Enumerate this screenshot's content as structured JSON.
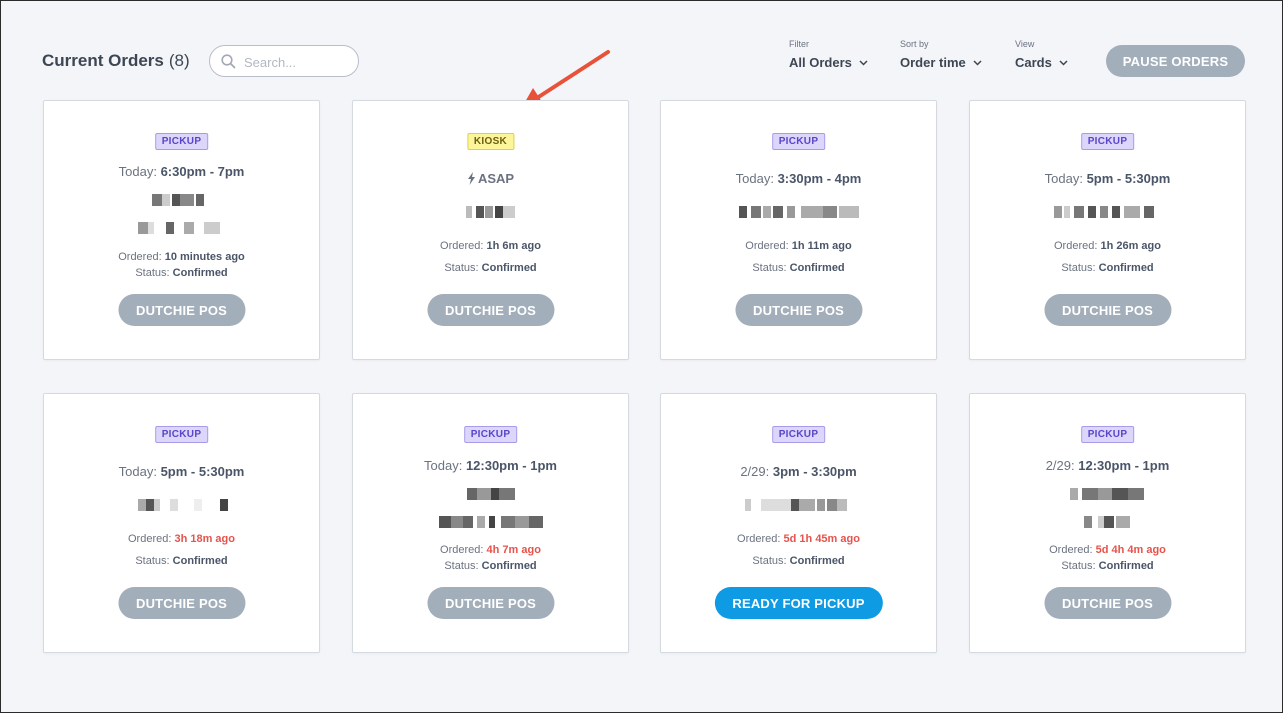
{
  "header": {
    "title": "Current Orders",
    "count": "(8)",
    "search_placeholder": "Search...",
    "filter": {
      "label": "Filter",
      "value": "All Orders"
    },
    "sort": {
      "label": "Sort by",
      "value": "Order time"
    },
    "view": {
      "label": "View",
      "value": "Cards"
    },
    "pause_label": "PAUSE ORDERS"
  },
  "labels": {
    "ordered": "Ordered:",
    "status": "Status:"
  },
  "orders": [
    {
      "type": "PICKUP",
      "time_prefix": "Today:",
      "time_range": "6:30pm - 7pm",
      "ordered_ago": "10 minutes ago",
      "status": "Confirmed",
      "action": "DUTCHIE POS"
    },
    {
      "type": "KIOSK",
      "time_prefix": "",
      "time_range": "ASAP",
      "ordered_ago": "1h 6m ago",
      "status": "Confirmed",
      "action": "DUTCHIE POS"
    },
    {
      "type": "PICKUP",
      "time_prefix": "Today:",
      "time_range": "3:30pm - 4pm",
      "ordered_ago": "1h 11m ago",
      "status": "Confirmed",
      "action": "DUTCHIE POS"
    },
    {
      "type": "PICKUP",
      "time_prefix": "Today:",
      "time_range": "5pm - 5:30pm",
      "ordered_ago": "1h 26m ago",
      "status": "Confirmed",
      "action": "DUTCHIE POS"
    },
    {
      "type": "PICKUP",
      "time_prefix": "Today:",
      "time_range": "5pm - 5:30pm",
      "ordered_ago": "3h 18m ago",
      "status": "Confirmed",
      "action": "DUTCHIE POS"
    },
    {
      "type": "PICKUP",
      "time_prefix": "Today:",
      "time_range": "12:30pm - 1pm",
      "ordered_ago": "4h 7m ago",
      "status": "Confirmed",
      "action": "DUTCHIE POS"
    },
    {
      "type": "PICKUP",
      "time_prefix": "2/29:",
      "time_range": "3pm - 3:30pm",
      "ordered_ago": "5d 1h 45m ago",
      "status": "Confirmed",
      "action": "READY FOR PICKUP"
    },
    {
      "type": "PICKUP",
      "time_prefix": "2/29:",
      "time_range": "12:30pm - 1pm",
      "ordered_ago": "5d 4h 4m ago",
      "status": "Confirmed",
      "action": "DUTCHIE POS"
    }
  ],
  "colors": {
    "late": "#e5534b",
    "primary_action": "#0f9ae4",
    "disabled_action": "#a3aebb",
    "arrow": "#e8513a"
  }
}
